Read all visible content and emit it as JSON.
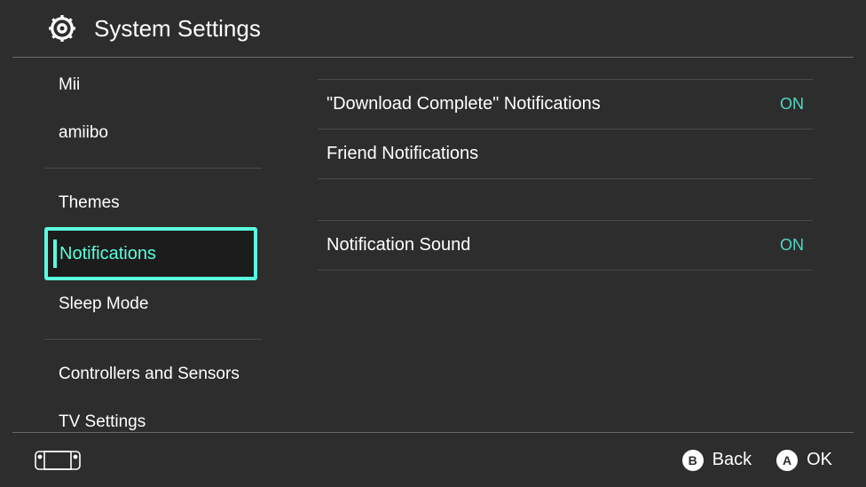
{
  "header": {
    "title": "System Settings"
  },
  "sidebar": {
    "items": [
      {
        "label": "Mii"
      },
      {
        "label": "amiibo"
      },
      {
        "label": "Themes"
      },
      {
        "label": "Notifications"
      },
      {
        "label": "Sleep Mode"
      },
      {
        "label": "Controllers and Sensors"
      },
      {
        "label": "TV Settings"
      }
    ]
  },
  "content": {
    "rows": [
      {
        "label": "\"Download Complete\" Notifications",
        "value": "ON"
      },
      {
        "label": "Friend Notifications",
        "value": ""
      },
      {
        "label": "Notification Sound",
        "value": "ON"
      }
    ]
  },
  "footer": {
    "back": {
      "glyph": "B",
      "label": "Back"
    },
    "ok": {
      "glyph": "A",
      "label": "OK"
    }
  }
}
